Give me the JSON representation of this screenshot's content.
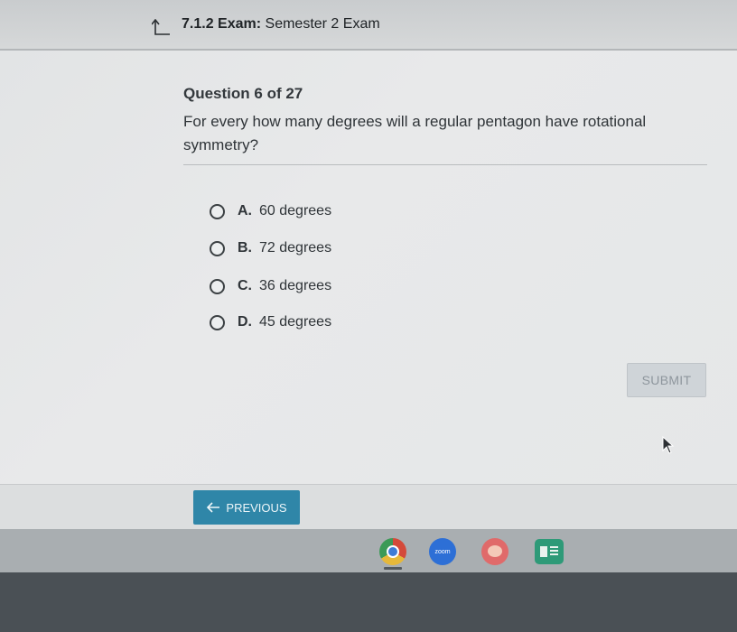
{
  "header": {
    "title_prefix": "7.1.2 Exam:",
    "title_rest": "Semester 2 Exam"
  },
  "question": {
    "number_label": "Question 6 of 27",
    "text": "For every how many degrees will a regular pentagon have rotational symmetry?",
    "options": [
      {
        "letter": "A.",
        "text": "60 degrees"
      },
      {
        "letter": "B.",
        "text": "72 degrees"
      },
      {
        "letter": "C.",
        "text": "36 degrees"
      },
      {
        "letter": "D.",
        "text": "45 degrees"
      }
    ]
  },
  "actions": {
    "submit_label": "SUBMIT",
    "previous_label": "PREVIOUS"
  },
  "taskbar": {
    "zoom_label": "zoom",
    "icons": [
      "chrome-icon",
      "zoom-icon",
      "palette-icon",
      "slides-icon"
    ]
  },
  "colors": {
    "accent": "#2f86a8",
    "submit_disabled": "#cfd4d8"
  }
}
